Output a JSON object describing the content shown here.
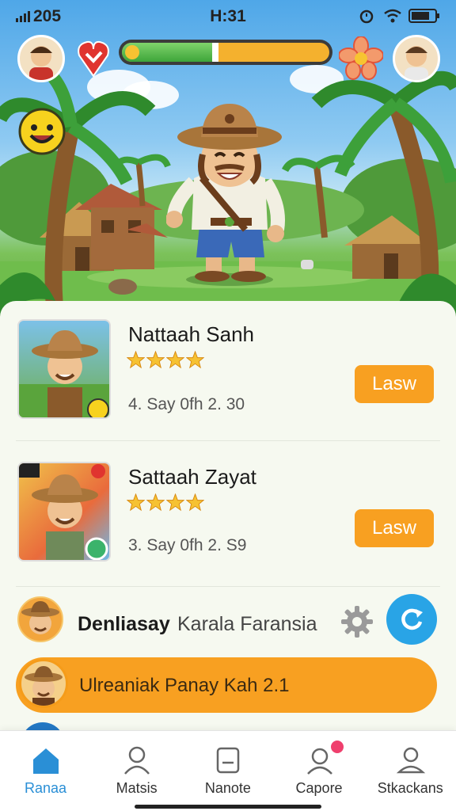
{
  "status": {
    "carrier": "205",
    "time": "H:31"
  },
  "hud": {
    "progress_fraction": 0.45
  },
  "cards": [
    {
      "title": "Nattaah Sanh",
      "stars": 4,
      "meta": "4. Say 0fh  2. 30",
      "button": "Lasw"
    },
    {
      "title": "Sattaah Zayat",
      "stars": 4,
      "meta": "3. Say 0fh  2. S9",
      "button": "Lasw"
    }
  ],
  "friend": {
    "name": "Denliasay",
    "subtitle": "Karala Faransia"
  },
  "banner": {
    "text": "Ulreaniak Panay Kah 2.1"
  },
  "tabs": [
    {
      "label": "Ranaa",
      "icon": "home-icon",
      "active": true
    },
    {
      "label": "Matsis",
      "icon": "person-icon",
      "active": false
    },
    {
      "label": "Nanote",
      "icon": "note-icon",
      "active": false
    },
    {
      "label": "Capore",
      "icon": "profile-notification-icon",
      "active": false
    },
    {
      "label": "Stkackans",
      "icon": "user-icon",
      "active": false
    }
  ],
  "colors": {
    "accent": "#f8a021",
    "tab_active": "#2a8fd6",
    "refresh": "#29a4e6",
    "star": "#f6c232"
  }
}
